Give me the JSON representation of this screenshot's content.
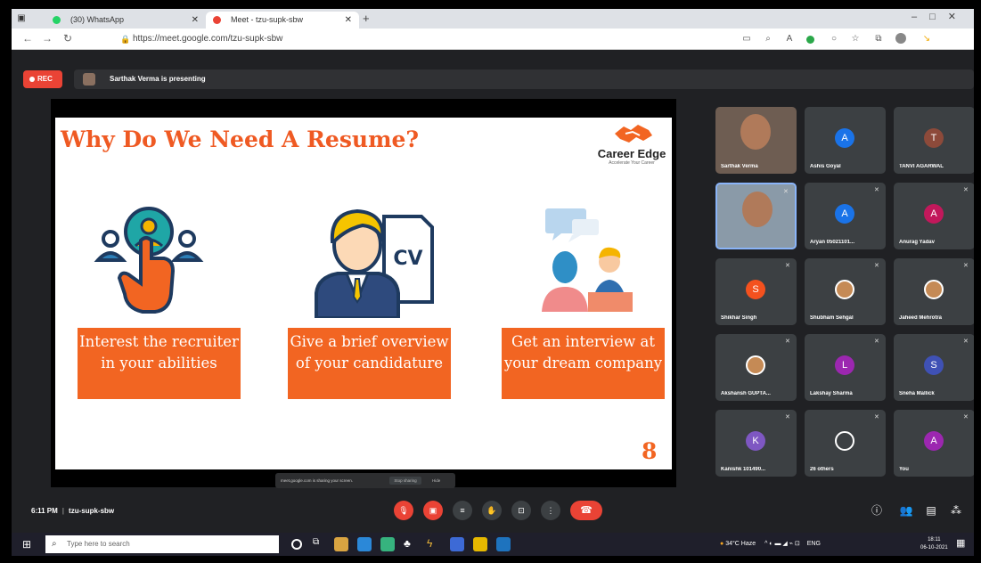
{
  "browser": {
    "tabs": [
      {
        "label": "(30) WhatsApp",
        "color": "#25d366"
      },
      {
        "label": "Meet - tzu-supk-sbw",
        "color": "#ea4335"
      }
    ],
    "url": "https://meet.google.com/tzu-supk-sbw"
  },
  "meet": {
    "rec_label": "REC",
    "presenter_text": "Sarthak Verma is presenting",
    "time": "6:11 PM",
    "meeting_code": "tzu-supk-sbw",
    "share_notice": "meet.google.com is sharing your screen.",
    "stop_sharing": "Stop sharing",
    "hide": "Hide"
  },
  "slide": {
    "title": "Why Do We Need A Resume?",
    "logo_name": "Career Edge",
    "logo_tagline": "Accelerate Your Career",
    "boxes": [
      "Interest the recruiter in your abilities",
      "Give a brief overview of your candidature",
      "Get an interview at your dream company"
    ],
    "cv_label": "CV",
    "page_number": "8"
  },
  "participants": [
    {
      "name": "Sarthak Verma",
      "type": "photo"
    },
    {
      "name": "Ashis Goyal",
      "initial": "A",
      "color": "#1a73e8"
    },
    {
      "name": "TANVI AGARWAL",
      "initial": "T",
      "color": "#8d4a3a"
    },
    {
      "name": "",
      "type": "photo"
    },
    {
      "name": "Aryan 05021101...",
      "initial": "A",
      "color": "#1a73e8"
    },
    {
      "name": "Anurag Yadav",
      "initial": "A",
      "color": "#c2185b"
    },
    {
      "name": "Shikhar Singh",
      "initial": "S",
      "color": "#f4511e"
    },
    {
      "name": "Shubham Sehgal",
      "type": "avatar"
    },
    {
      "name": "Jaheed Mehrotra",
      "type": "avatar"
    },
    {
      "name": "Akshansh GUPTA...",
      "type": "avatar"
    },
    {
      "name": "Lakshay Sharma",
      "initial": "L",
      "color": "#9c27b0"
    },
    {
      "name": "Sneha Mallick",
      "initial": "S",
      "color": "#3f51b5"
    },
    {
      "name": "Kanishk 101490...",
      "initial": "K",
      "color": "#7e57c2"
    },
    {
      "name": "26 others",
      "type": "group"
    },
    {
      "name": "You",
      "initial": "A",
      "color": "#9c27b0"
    }
  ],
  "taskbar": {
    "search_placeholder": "Type here to search",
    "weather": "34°C Haze",
    "lang": "ENG",
    "time": "18:11",
    "date": "06-10-2021"
  }
}
